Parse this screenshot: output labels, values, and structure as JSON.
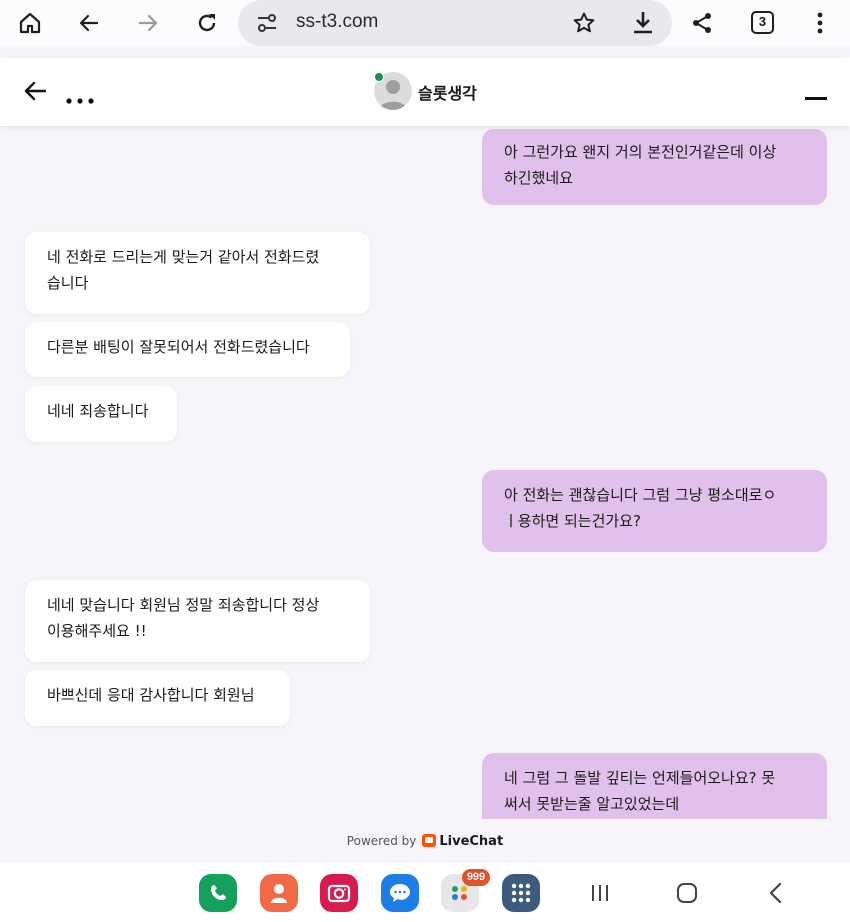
{
  "browser": {
    "url": "ss-t3.com",
    "tab_count": "3",
    "icons": [
      "home-icon",
      "back-arrow-icon",
      "forward-arrow-icon",
      "reload-icon",
      "site-settings-icon",
      "star-icon",
      "download-icon",
      "share-icon",
      "tabs-icon",
      "more-vert-icon"
    ]
  },
  "chat_header": {
    "title": "슬롯생각",
    "status_color": "#1b8f4c"
  },
  "messages": [
    {
      "side": "out",
      "lines": [
        "아 그런가요 왠지 거의 본전인거같은데 이상",
        "하긴했네요"
      ]
    },
    {
      "side": "in",
      "lines": [
        "네 전화로 드리는게 맞는거 같아서 전화드렸",
        "습니다"
      ]
    },
    {
      "side": "in",
      "lines": [
        "다른분 배팅이 잘못되어서 전화드렸습니다"
      ]
    },
    {
      "side": "in",
      "lines": [
        "네네 죄송합니다"
      ]
    },
    {
      "side": "out",
      "lines": [
        "아 전화는 괜찮습니다 그럼 그냥 평소대로ㅇ",
        "ㅣ용하면 되는건가요?"
      ]
    },
    {
      "side": "in",
      "lines": [
        "네네 맞습니다 회원님 정말 죄송합니다 정상",
        "이용해주세요 !!"
      ]
    },
    {
      "side": "in",
      "lines": [
        "바쁘신데 응대 감사합니다 회원님"
      ]
    },
    {
      "side": "out",
      "lines": [
        "네 그럼 그 돌발 깊티는 언제들어오나요? 못",
        "써서 못받는줄 알고있었는데"
      ]
    }
  ],
  "footer": {
    "powered_by": "Powered by",
    "brand": "LiveChat"
  },
  "dock": {
    "badge": "999",
    "apps": [
      "phone-app-icon",
      "contacts-app-icon",
      "camera-app-icon",
      "messages-app-icon",
      "app-folder-icon",
      "app-drawer-icon"
    ]
  },
  "colors": {
    "outgoing_bubble": "#e2c0ec",
    "incoming_bubble": "#ffffff",
    "background": "#f7f5f9",
    "livechat_brand": "#ff5100"
  }
}
